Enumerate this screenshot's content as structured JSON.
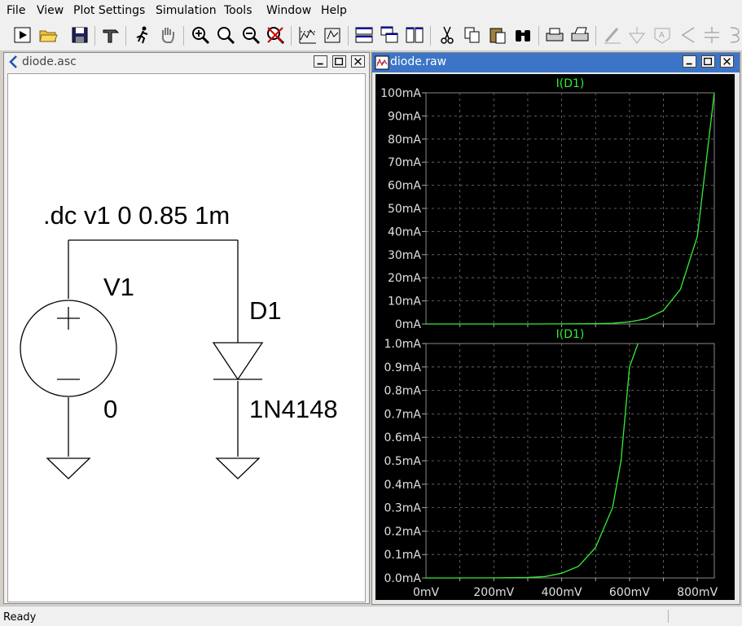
{
  "menu": {
    "file": "File",
    "view": "View",
    "plot_settings": "Plot Settings",
    "simulation": "Simulation",
    "tools": "Tools",
    "window": "Window",
    "help": "Help"
  },
  "schematic_window": {
    "title": "diode.asc",
    "directive": ".dc v1 0 0.85 1m",
    "source_label": "V1",
    "source_value": "0",
    "diode_label": "D1",
    "diode_model": "1N4148"
  },
  "plot_window": {
    "title": "diode.raw",
    "trace_color": "#33ee33"
  },
  "chart_data": [
    {
      "type": "line",
      "title": "I(D1)",
      "x": [
        0,
        100,
        200,
        300,
        400,
        500,
        550,
        600,
        650,
        700,
        750,
        800,
        850
      ],
      "series": [
        {
          "name": "I(D1)",
          "values": [
            0,
            0,
            0,
            0,
            0.02,
            0.13,
            0.3,
            0.9,
            2.3,
            5.8,
            15,
            38,
            100
          ]
        }
      ],
      "x_unit": "mV",
      "y_unit": "mA",
      "xlim": [
        0,
        850
      ],
      "ylim": [
        0,
        100
      ],
      "yticks": [
        "100mA",
        "90mA",
        "80mA",
        "70mA",
        "60mA",
        "50mA",
        "40mA",
        "30mA",
        "20mA",
        "10mA",
        "0mA"
      ],
      "grid": true
    },
    {
      "type": "line",
      "title": "I(D1)",
      "x": [
        0,
        100,
        200,
        300,
        350,
        400,
        450,
        500,
        550,
        575,
        600,
        625
      ],
      "series": [
        {
          "name": "I(D1)",
          "values": [
            0,
            0,
            0.0005,
            0.002,
            0.006,
            0.02,
            0.05,
            0.13,
            0.3,
            0.5,
            0.9,
            1.0
          ]
        }
      ],
      "x_unit": "mV",
      "y_unit": "mA",
      "xlim": [
        0,
        850
      ],
      "ylim": [
        0,
        1.0
      ],
      "yticks": [
        "1.0mA",
        "0.9mA",
        "0.8mA",
        "0.7mA",
        "0.6mA",
        "0.5mA",
        "0.4mA",
        "0.3mA",
        "0.2mA",
        "0.1mA",
        "0.0mA"
      ],
      "xticks": [
        "0mV",
        "200mV",
        "400mV",
        "600mV",
        "800mV"
      ],
      "grid": true
    }
  ],
  "status": {
    "text": "Ready"
  },
  "icons": {
    "toolbar": [
      "run-icon",
      "open-icon",
      "save-icon",
      "control-panel-icon",
      "halt-icon",
      "pan-icon",
      "zoom-in-icon",
      "zoom-area-icon",
      "zoom-out-icon",
      "zoom-fit-icon",
      "autorange-icon",
      "plot-settings-icon",
      "tile-horizontal-icon",
      "cascade-icon",
      "tile-vertical-icon",
      "cut-icon",
      "copy-icon",
      "paste-icon",
      "find-icon",
      "print-icon",
      "print-setup-icon",
      "draw-wire-icon",
      "ground-icon",
      "label-net-icon",
      "resistor-icon",
      "capacitor-icon"
    ]
  }
}
